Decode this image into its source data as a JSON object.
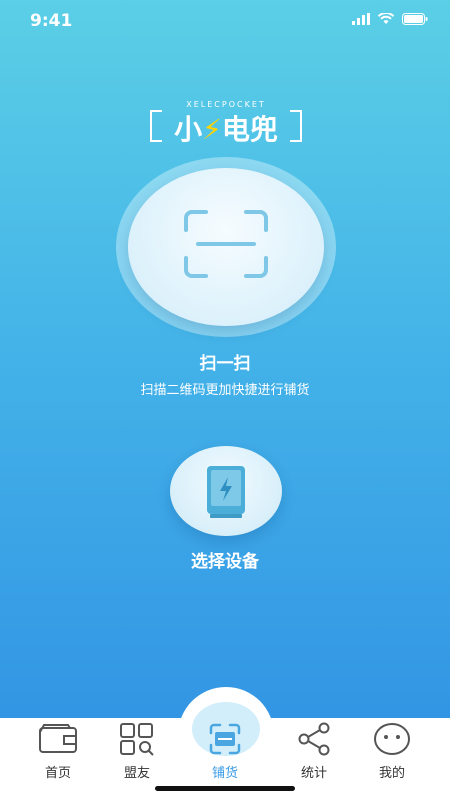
{
  "status_bar": {
    "time": "9:41"
  },
  "logo": {
    "subtitle": "XELECPOCKET",
    "title_part1": "小",
    "title_bolt": "⚡",
    "title_part2": "电兜"
  },
  "scan": {
    "title": "扫一扫",
    "description": "扫描二维码更加快捷进行铺货"
  },
  "device": {
    "label": "选择设备"
  },
  "tabs": [
    {
      "label": "首页",
      "icon": "wallet-icon"
    },
    {
      "label": "盟友",
      "icon": "grid-search-icon"
    },
    {
      "label": "铺货",
      "icon": "scan-icon",
      "active": true
    },
    {
      "label": "统计",
      "icon": "share-icon"
    },
    {
      "label": "我的",
      "icon": "face-icon"
    }
  ],
  "colors": {
    "accent": "#3a9be6",
    "bg_top": "#5bcfe6",
    "bg_bottom": "#2f8fe3",
    "bolt": "#ffd400"
  }
}
